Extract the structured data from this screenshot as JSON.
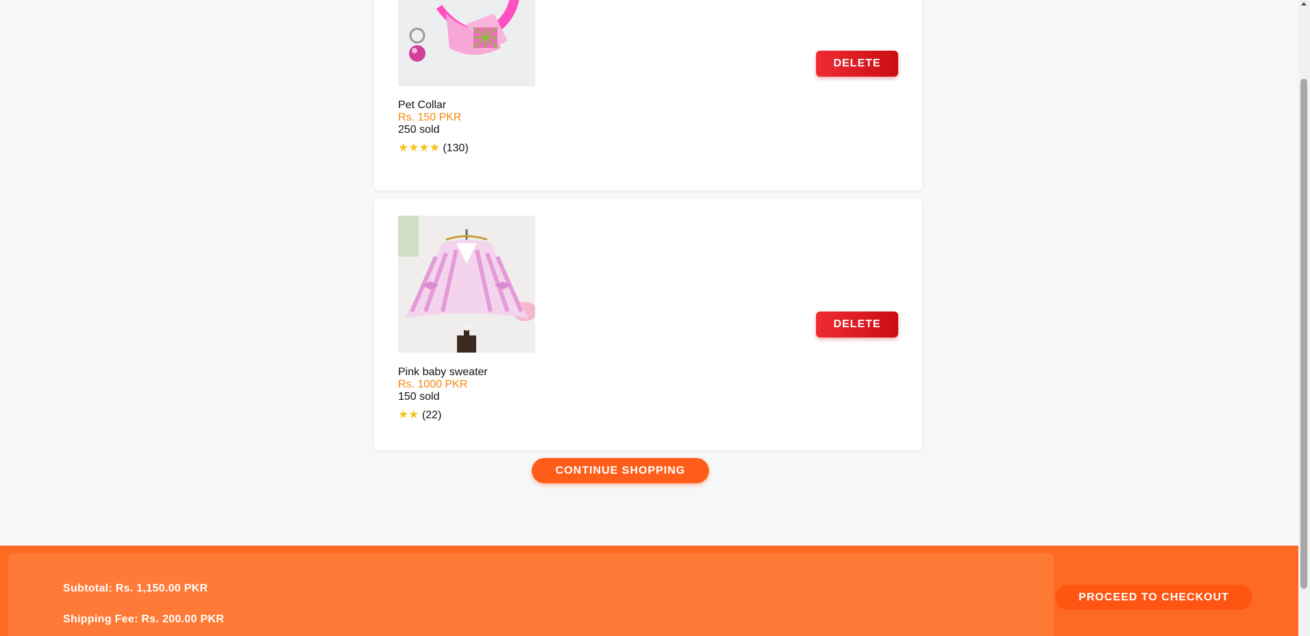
{
  "cart": {
    "items": [
      {
        "name": "Pet Collar",
        "price": "Rs. 150 PKR",
        "sold": "250 sold",
        "stars": "★★★★",
        "reviews": "(130)",
        "rating_stars": 4,
        "delete_label": "DELETE",
        "image": "pink-bow-collar-image"
      },
      {
        "name": "Pink baby sweater",
        "price": "Rs. 1000 PKR",
        "sold": "150 sold",
        "stars": "★★",
        "reviews": "(22)",
        "rating_stars": 2,
        "delete_label": "DELETE",
        "image": "pink-striped-sweater-image"
      }
    ],
    "continue_label": "CONTINUE SHOPPING"
  },
  "summary": {
    "subtotal": "Subtotal: Rs. 1,150.00 PKR",
    "shipping": "Shipping Fee: Rs. 200.00 PKR",
    "checkout_label": "PROCEED TO CHECKOUT"
  },
  "colors": {
    "accent": "#ff6a22",
    "delete": "#e11a22",
    "price": "#f5870a",
    "star": "#f6c21a"
  }
}
